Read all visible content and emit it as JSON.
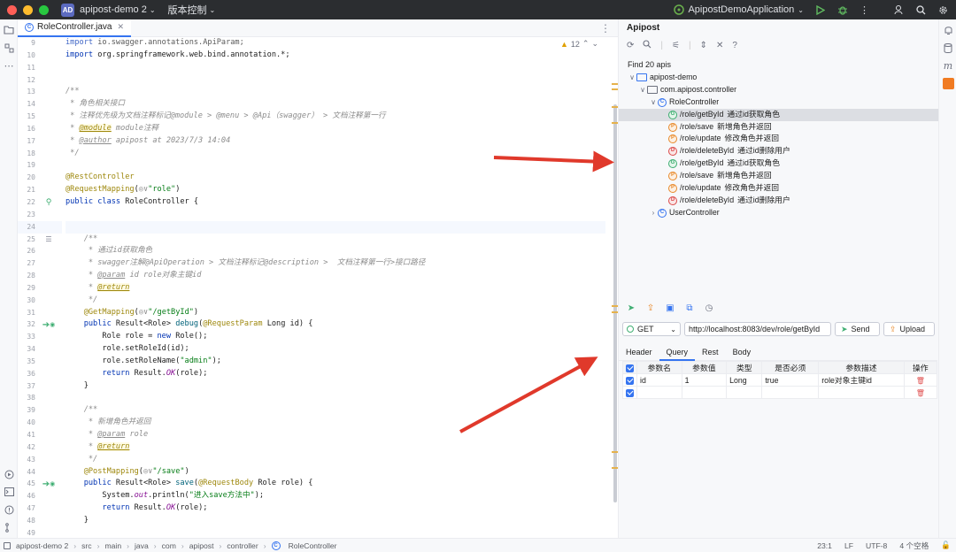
{
  "titlebar": {
    "project_badge": "AD",
    "project": "apipost-demo 2",
    "vcs": "版本控制",
    "run_config": "ApipostDemoApplication"
  },
  "editor": {
    "tab_label": "RoleController.java",
    "inspection_count": "12",
    "lines": [
      {
        "n": "9",
        "html": "<span class='kw'>import</span> io.swagger.annotations.ApiParam;",
        "faded": true
      },
      {
        "n": "10",
        "html": "<span class='kw'>import</span> org.springframework.web.bind.annotation.*;"
      },
      {
        "n": "11",
        "html": ""
      },
      {
        "n": "12",
        "html": ""
      },
      {
        "n": "13",
        "html": "<span class='cm'>/**</span>"
      },
      {
        "n": "14",
        "html": "<span class='cm'> * 角色相关接口</span>"
      },
      {
        "n": "15",
        "html": "<span class='cm'> * 注释优先级为文档注释标记@module &gt; @menu &gt; @Api（swagger） &gt; 文档注释第一行</span>"
      },
      {
        "n": "16",
        "html": "<span class='cm'> * </span><span class='docann'>@module</span><span class='cm'> module注释</span>"
      },
      {
        "n": "17",
        "html": "<span class='cm'> * </span><span class='doctag'>@author</span><span class='cm'> apipost at 2023/7/3 14:04</span>"
      },
      {
        "n": "18",
        "html": "<span class='cm'> */</span>"
      },
      {
        "n": "19",
        "html": ""
      },
      {
        "n": "20",
        "html": "<span class='ann'>@RestController</span>"
      },
      {
        "n": "21",
        "html": "<span class='ann'>@RequestMapping</span>(<span class='cm'>◎∨</span><span class='str'>\"role\"</span>)"
      },
      {
        "n": "22",
        "html": "<span class='kw'>public class</span> RoleController {",
        "mark": "bean"
      },
      {
        "n": "23",
        "html": ""
      },
      {
        "n": "24",
        "html": "",
        "highlight": true
      },
      {
        "n": "25",
        "html": "    <span class='cm'>/**</span>",
        "mark": "doc"
      },
      {
        "n": "26",
        "html": "<span class='cm'>     * 通过id获取角色</span>"
      },
      {
        "n": "27",
        "html": "<span class='cm'>     * swagger注解@ApiOperation &gt; 文档注释标记@description &gt;  文档注释第一行&gt;接口路径</span>"
      },
      {
        "n": "28",
        "html": "<span class='cm'>     * </span><span class='doctag'>@param</span><span class='cm'> id role对象主键id</span>"
      },
      {
        "n": "29",
        "html": "<span class='cm'>     * </span><span class='docann'>@return</span>"
      },
      {
        "n": "30",
        "html": "<span class='cm'>     */</span>"
      },
      {
        "n": "31",
        "html": "    <span class='ann'>@GetMapping</span>(<span class='cm'>◎∨</span><span class='str'>\"/getById\"</span>)"
      },
      {
        "n": "32",
        "html": "    <span class='kw'>public</span> Result&lt;Role&gt; <span class='fn'>debug</span>(<span class='ann'>@RequestParam</span> Long id) {",
        "mark": "run"
      },
      {
        "n": "33",
        "html": "        Role role = <span class='kw'>new</span> Role();"
      },
      {
        "n": "34",
        "html": "        role.setRoleId(id);"
      },
      {
        "n": "35",
        "html": "        role.setRoleName(<span class='str'>\"admin\"</span>);"
      },
      {
        "n": "36",
        "html": "        <span class='kw'>return</span> Result.<span class='static'>OK</span>(role);"
      },
      {
        "n": "37",
        "html": "    }"
      },
      {
        "n": "38",
        "html": ""
      },
      {
        "n": "39",
        "html": "    <span class='cm'>/**</span>"
      },
      {
        "n": "40",
        "html": "<span class='cm'>     * 新增角色并返回</span>"
      },
      {
        "n": "41",
        "html": "<span class='cm'>     * </span><span class='doctag'>@param</span><span class='cm'> role</span>"
      },
      {
        "n": "42",
        "html": "<span class='cm'>     * </span><span class='docann'>@return</span>"
      },
      {
        "n": "43",
        "html": "<span class='cm'>     */</span>"
      },
      {
        "n": "44",
        "html": "    <span class='ann'>@PostMapping</span>(<span class='cm'>◎∨</span><span class='str'>\"/save\"</span>)"
      },
      {
        "n": "45",
        "html": "    <span class='kw'>public</span> Result&lt;Role&gt; <span class='fn'>save</span>(<span class='ann'>@RequestBody</span> Role role) {",
        "mark": "run"
      },
      {
        "n": "46",
        "html": "        System.<span class='static'>out</span>.println(<span class='str'>\"进入save方法中\"</span>);"
      },
      {
        "n": "47",
        "html": "        <span class='kw'>return</span> Result.<span class='static'>OK</span>(role);"
      },
      {
        "n": "48",
        "html": "    }"
      },
      {
        "n": "49",
        "html": ""
      }
    ]
  },
  "apipost": {
    "title": "Apipost",
    "find_label": "Find 20 apis",
    "tree": [
      {
        "level": 0,
        "type": "root",
        "label": "apipost-demo",
        "chev": "∨"
      },
      {
        "level": 1,
        "type": "package",
        "label": "com.apipost.controller",
        "chev": "∨"
      },
      {
        "level": 2,
        "type": "class",
        "label": "RoleController",
        "chev": "∨"
      },
      {
        "level": 3,
        "type": "api",
        "method": "G",
        "path": "/role/getById",
        "desc": "通过id获取角色",
        "selected": true
      },
      {
        "level": 3,
        "type": "api",
        "method": "P",
        "path": "/role/save",
        "desc": "新增角色并返回"
      },
      {
        "level": 3,
        "type": "api",
        "method": "P",
        "path": "/role/update",
        "desc": "修改角色并返回"
      },
      {
        "level": 3,
        "type": "api",
        "method": "D",
        "path": "/role/deleteById",
        "desc": "通过id删除用户"
      },
      {
        "level": 3,
        "type": "api",
        "method": "G",
        "path": "/role/getById",
        "desc": "通过id获取角色"
      },
      {
        "level": 3,
        "type": "api",
        "method": "P",
        "path": "/role/save",
        "desc": "新增角色并返回"
      },
      {
        "level": 3,
        "type": "api",
        "method": "P",
        "path": "/role/update",
        "desc": "修改角色并返回"
      },
      {
        "level": 3,
        "type": "api",
        "method": "D",
        "path": "/role/deleteById",
        "desc": "通过id删除用户"
      },
      {
        "level": 2,
        "type": "class",
        "label": "UserController",
        "chev": "›"
      }
    ],
    "request": {
      "method": "GET",
      "url": "http://localhost:8083/dev/role/getById",
      "send_label": "Send",
      "upload_label": "Upload"
    },
    "tabs": [
      "Header",
      "Query",
      "Rest",
      "Body"
    ],
    "active_tab": "Query",
    "table": {
      "headers": [
        "参数名",
        "参数值",
        "类型",
        "是否必须",
        "参数描述",
        "操作"
      ],
      "rows": [
        {
          "name": "id",
          "value": "1",
          "type": "Long",
          "required": "true",
          "desc": "role对象主键id"
        },
        {
          "name": "",
          "value": "",
          "type": "",
          "required": "",
          "desc": ""
        }
      ]
    }
  },
  "statusbar": {
    "breadcrumb": [
      "apipost-demo 2",
      "src",
      "main",
      "java",
      "com",
      "apipost",
      "controller",
      "RoleController"
    ],
    "position": "23:1",
    "line_sep": "LF",
    "encoding": "UTF-8",
    "indent": "4 个空格"
  },
  "colors": {
    "accent": "#3574f0",
    "arrow": "#e0392b",
    "get": "#3fae72",
    "post": "#e88a2c",
    "delete": "#db4c4c"
  }
}
